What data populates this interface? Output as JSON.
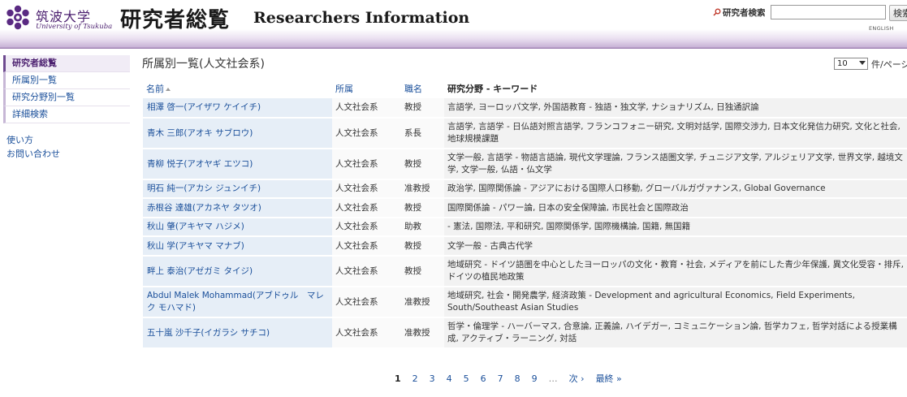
{
  "header": {
    "logo_jp": "筑波大学",
    "logo_en": "University of Tsukuba",
    "title_jp": "研究者総覧",
    "title_en": "Researchers Information",
    "search_label": "研究者検索",
    "search_value": "",
    "search_button": "検索",
    "lang_link": "ENGLISH",
    "brand_color": "#4b1f6f"
  },
  "sidebar": {
    "items": [
      {
        "label": "研究者総覧",
        "active": true
      },
      {
        "label": "所属別一覧"
      },
      {
        "label": "研究分野別一覧"
      },
      {
        "label": "詳細検索"
      }
    ],
    "links": [
      "使い方",
      "お問い合わせ"
    ]
  },
  "main": {
    "title": "所属別一覧(人文社会系)",
    "per_page_value": "10",
    "per_page_suffix": "件/ページ",
    "columns": [
      "名前",
      "所属",
      "職名",
      "研究分野 - キーワード"
    ],
    "rows": [
      {
        "name": "相澤 啓一(アイザワ ケイイチ)",
        "affiliation": "人文社会系",
        "position": "教授",
        "keywords": "言語学, ヨーロッパ文学, 外国語教育 - 独語・独文学, ナショナリズム, 日独通訳論"
      },
      {
        "name": "青木 三郎(アオキ サブロウ)",
        "affiliation": "人文社会系",
        "position": "系長",
        "keywords": "言語学, 言語学 - 日仏語対照言語学, フランコフォニー研究, 文明対話学, 国際交渉力, 日本文化発信力研究, 文化と社会, 地球規模課題"
      },
      {
        "name": "青柳 悦子(アオヤギ エツコ)",
        "affiliation": "人文社会系",
        "position": "教授",
        "keywords": "文学一般, 言語学 - 物語言語論, 現代文学理論, フランス語圏文学, チュニジア文学, アルジェリア文学, 世界文学, 越境文学, 文学一般, 仏語・仏文学"
      },
      {
        "name": "明石 純一(アカシ ジュンイチ)",
        "affiliation": "人文社会系",
        "position": "准教授",
        "keywords": "政治学, 国際関係論 - アジアにおける国際人口移動, グローバルガヴァナンス, Global Governance"
      },
      {
        "name": "赤根谷 達雄(アカネヤ タツオ)",
        "affiliation": "人文社会系",
        "position": "教授",
        "keywords": "国際関係論 - パワー論, 日本の安全保障論, 市民社会と国際政治"
      },
      {
        "name": "秋山 肇(アキヤマ ハジメ)",
        "affiliation": "人文社会系",
        "position": "助教",
        "keywords": "- 憲法, 国際法, 平和研究, 国際関係学, 国際機構論, 国籍, 無国籍"
      },
      {
        "name": "秋山 学(アキヤマ マナブ)",
        "affiliation": "人文社会系",
        "position": "教授",
        "keywords": "文学一般 - 古典古代学"
      },
      {
        "name": "畔上 泰治(アゼガミ タイジ)",
        "affiliation": "人文社会系",
        "position": "教授",
        "keywords": "地域研究 - ドイツ語圏を中心としたヨーロッパの文化・教育・社会, メディアを前にした青少年保護, 異文化受容・排斥, ドイツの植民地政策"
      },
      {
        "name": "Abdul Malek Mohammad(アブドゥル　マレク モハマド)",
        "affiliation": "人文社会系",
        "position": "准教授",
        "keywords": "地域研究, 社会・開発農学, 経済政策 - Development and agricultural Economics, Field Experiments, South/Southeast Asian Studies"
      },
      {
        "name": "五十嵐 沙千子(イガラシ サチコ)",
        "affiliation": "人文社会系",
        "position": "准教授",
        "keywords": "哲学・倫理学 - ハーバーマス, 合意論, 正義論, ハイデガー, コミュニケーション論, 哲学カフェ, 哲学対話による授業構成, アクティブ・ラーニング, 対話"
      }
    ]
  },
  "pagination": {
    "pages": [
      "1",
      "2",
      "3",
      "4",
      "5",
      "6",
      "7",
      "8",
      "9"
    ],
    "current": "1",
    "ellipsis": "…",
    "next": "次 ›",
    "last": "最終 »"
  }
}
